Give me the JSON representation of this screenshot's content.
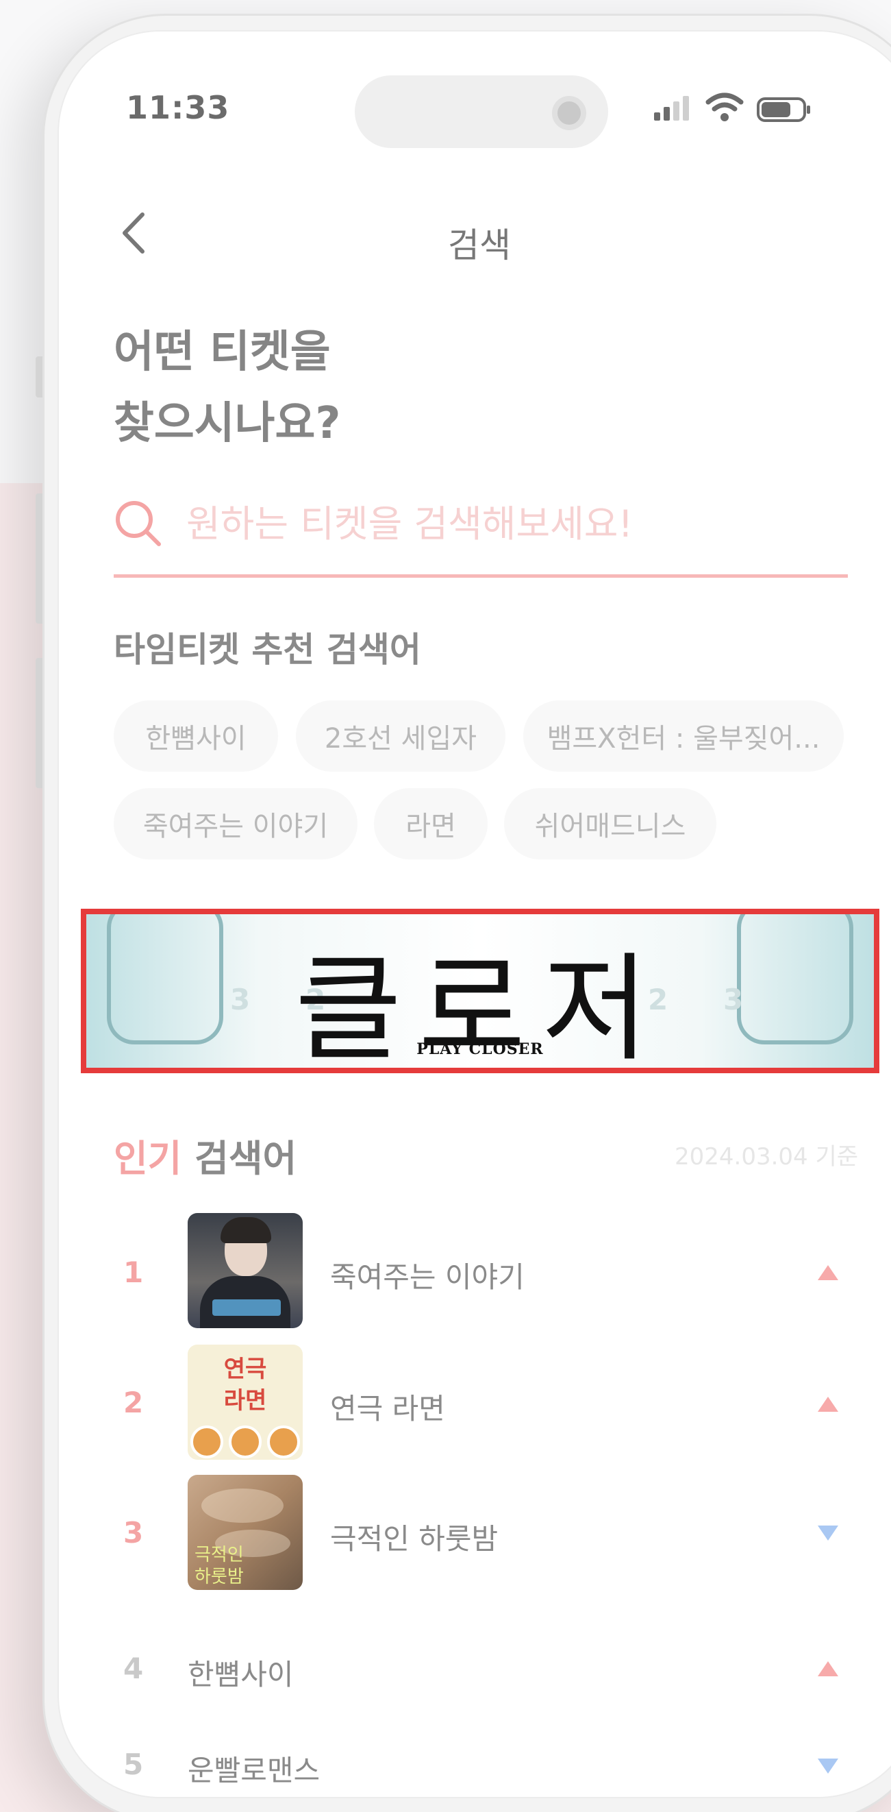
{
  "status_bar": {
    "time": "11:33"
  },
  "header": {
    "title": "검색"
  },
  "heading": {
    "line1": "어떤 티켓을",
    "line2": "찾으시나요?"
  },
  "search": {
    "placeholder": "원하는 티켓을 검색해보세요!"
  },
  "recommended": {
    "title": "타임티켓 추천 검색어",
    "chips": [
      "한뼘사이",
      "2호선 세입자",
      "뱀프X헌터 : 울부짖어...",
      "죽여주는 이야기",
      "라면",
      "쉬어매드니스"
    ]
  },
  "banner": {
    "title": "클로저",
    "subtitle": "PLAY CLOSER",
    "decor_numbers": [
      "3",
      "2",
      "2",
      "3"
    ]
  },
  "popular": {
    "title_accent": "인기",
    "title_rest": " 검색어",
    "date": "2024.03.04 기준",
    "items": [
      {
        "rank": "1",
        "title": "죽여주는 이야기",
        "trend": "up",
        "has_thumb": true
      },
      {
        "rank": "2",
        "title": "연극 라면",
        "trend": "up",
        "has_thumb": true
      },
      {
        "rank": "3",
        "title": "극적인 하룻밤",
        "trend": "down",
        "has_thumb": true
      },
      {
        "rank": "4",
        "title": "한뼘사이",
        "trend": "up",
        "has_thumb": false
      },
      {
        "rank": "5",
        "title": "운빨로맨스",
        "trend": "down",
        "has_thumb": false
      }
    ],
    "thumb2_text": [
      "연극",
      "라면"
    ],
    "thumb3_text": [
      "극적인",
      "하룻밤"
    ]
  },
  "colors": {
    "accent": "#f4a4a4",
    "highlight_border": "#e53b3b",
    "trend_up": "#f7aaaa",
    "trend_down": "#a9c8f3"
  }
}
